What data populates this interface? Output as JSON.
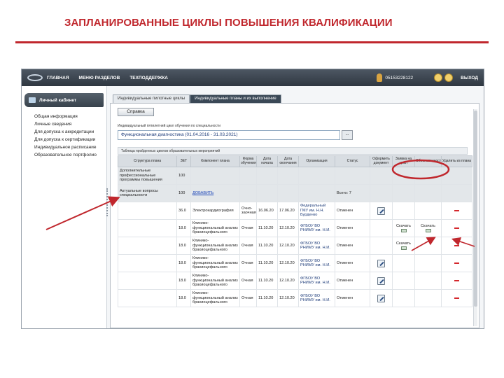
{
  "slide": {
    "title": "ЗАПЛАНИРОВАННЫЕ ЦИКЛЫ ПОВЫШЕНИЯ КВАЛИФИКАЦИИ"
  },
  "topbar": {
    "nav": [
      "ГЛАВНАЯ",
      "МЕНЮ РАЗДЕЛОВ",
      "ТЕХПОДДЕРЖКА"
    ],
    "phone": "05153228122",
    "exit": "ВЫХОД"
  },
  "sidebar": {
    "cabinet_label": "Личный кабинет",
    "items": [
      "Общая информация",
      "Личные сведения",
      "Для допуска к аккредитации",
      "Для допуска к сертификации",
      "Индивидуальное расписание",
      "Образовательное портфолио"
    ]
  },
  "tabs": [
    {
      "label": "Индивидуальные пилотные циклы"
    },
    {
      "label": "Индивидуальные планы и их выполнение"
    }
  ],
  "panel": {
    "spravka_label": "Справка",
    "plan_label": "Индивидуальный пятилетний цикл обучения по специальности",
    "plan_value": "Функциональная диагностика (01.04.2016 - 31.03.2021)",
    "plan_button": "...",
    "table_title": "Таблица пройденных циклов образовательных мероприятий"
  },
  "table": {
    "headers": [
      "Структура плана",
      "ЗЕТ",
      "Компонент плана",
      "Форма обучения",
      "Дата начала",
      "Дата окончания",
      "Организация",
      "Статус",
      "Оформить документ",
      "Заявка на цикл",
      "Обоснованность",
      "Удалить из плана"
    ],
    "group_rows": [
      {
        "structure": "Дополнительные профессиональные программы повышения",
        "zet": "100"
      },
      {
        "structure": "Актуальные вопросы специальности",
        "zet": "100",
        "component": "ДОБАВИТЬ",
        "status": "Всего: 7"
      }
    ],
    "rows": [
      {
        "zet": "36.0",
        "component": "Электрокардиография",
        "form": "Очно-заочная",
        "start": "16.06.20",
        "end": "17.06.20",
        "org": "Федеральный ГМУ им. Н.Н. Бурденко",
        "status": "Отменен",
        "edit": true,
        "apply": "",
        "basis": "",
        "remove": true
      },
      {
        "zet": "18.0",
        "component": "Клинико-функциональный анализ брахиоцефального",
        "form": "Очная",
        "start": "11.10.20",
        "end": "12.10.20",
        "org": "ФГБОУ ВО РНИМУ им. Н.И.",
        "status": "Отменен",
        "edit": false,
        "apply": "Скачать",
        "basis": "Скачать",
        "remove": true
      },
      {
        "zet": "18.0",
        "component": "Клинико-функциональный анализ брахиоцефального",
        "form": "Очная",
        "start": "11.10.20",
        "end": "12.10.20",
        "org": "ФГБОУ ВО РНИМУ им. Н.И.",
        "status": "Отменен",
        "edit": false,
        "apply": "Скачать",
        "basis": "",
        "remove": true
      },
      {
        "zet": "18.0",
        "component": "Клинико-функциональный анализ брахиоцефального",
        "form": "Очная",
        "start": "11.10.20",
        "end": "12.10.20",
        "org": "ФГБОУ ВО РНИМУ им. Н.И.",
        "status": "Отменен",
        "edit": true,
        "apply": "",
        "basis": "",
        "remove": true
      },
      {
        "zet": "18.0",
        "component": "Клинико-функциональный анализ брахиоцефального",
        "form": "Очная",
        "start": "11.10.20",
        "end": "12.10.20",
        "org": "ФГБОУ ВО РНИМУ им. Н.И.",
        "status": "Отменен",
        "edit": true,
        "apply": "",
        "basis": "",
        "remove": true
      },
      {
        "zet": "18.0",
        "component": "Клинико-функциональный анализ брахиоцефального",
        "form": "Очная",
        "start": "11.10.20",
        "end": "12.10.20",
        "org": "ФГБОУ ВО РНИМУ им. Н.И.",
        "status": "Отменен",
        "edit": true,
        "apply": "",
        "basis": "",
        "remove": true
      }
    ]
  },
  "colors": {
    "title_red": "#c0272d",
    "annotation_red": "#c0272d",
    "link_blue": "#1a44b8",
    "org_blue": "#1f3d7a"
  },
  "icons": [
    "user-icon",
    "search-icon",
    "edit-icon",
    "download-icon",
    "remove-icon"
  ]
}
